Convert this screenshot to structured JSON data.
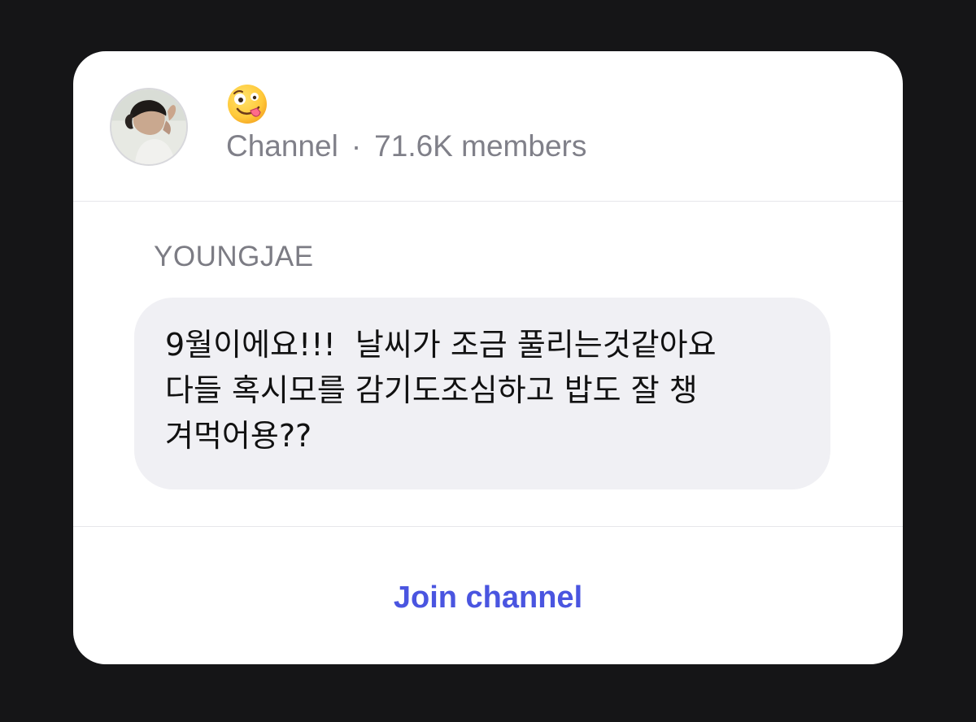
{
  "channel": {
    "emoji": "🤪",
    "emoji_icon": "zany-face-icon",
    "type_label": "Channel",
    "separator": "·",
    "members": "71.6K members"
  },
  "message": {
    "author": "YOUNGJAE",
    "text": "9월이에요!!!  날씨가 조금 풀리는것같아요\n다들 혹시모를 감기도조심하고 밥도 잘 챙\n겨먹어용??"
  },
  "footer": {
    "join_label": "Join channel"
  },
  "colors": {
    "background": "#151517",
    "card": "#ffffff",
    "meta_text": "#808089",
    "bubble": "#f0f0f4",
    "accent": "#4a55e0"
  }
}
